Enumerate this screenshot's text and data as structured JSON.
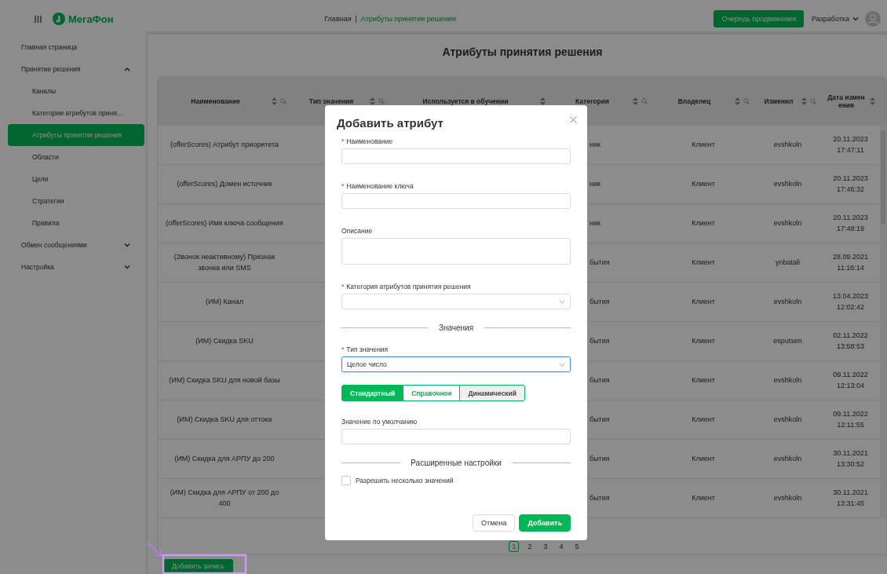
{
  "header": {
    "brand": "МегаФон",
    "breadcrumb": [
      {
        "label": "Главная",
        "current": false
      },
      {
        "label": "Атрибуты принятия решения",
        "current": true
      }
    ],
    "breadcrumb_separator": "|",
    "queue_button": "Очередь продвижения",
    "environment": "Разработка"
  },
  "sidebar": {
    "items": [
      {
        "label": "Главная страница",
        "selected": false
      },
      {
        "label": "Принятие решения",
        "selected": false,
        "expanded": true,
        "children": [
          {
            "label": "Каналы",
            "selected": false
          },
          {
            "label": "Категории атрибутов приня...",
            "selected": false
          },
          {
            "label": "Атрибуты принятия решения",
            "selected": true
          },
          {
            "label": "Области",
            "selected": false
          },
          {
            "label": "Цели",
            "selected": false
          },
          {
            "label": "Стратегии",
            "selected": false
          },
          {
            "label": "Правила",
            "selected": false
          }
        ]
      },
      {
        "label": "Обмен сообщениями",
        "selected": false,
        "expanded": false
      },
      {
        "label": "Настройка",
        "selected": false,
        "expanded": false
      }
    ]
  },
  "page_title": "Атрибуты принятия решения",
  "table": {
    "columns": [
      {
        "label": "Наименование",
        "sortable": true,
        "searchable": true
      },
      {
        "label": "Тип значения",
        "sortable": true,
        "searchable": true
      },
      {
        "label": "Используется в обучении",
        "sortable": true,
        "searchable": false
      },
      {
        "label": "Категория",
        "sortable": true,
        "searchable": true
      },
      {
        "label": "Владелец",
        "sortable": true,
        "searchable": true
      },
      {
        "label": "Изменил",
        "sortable": true,
        "searchable": true
      },
      {
        "label": "Дата изменения",
        "sortable": true,
        "searchable": false
      }
    ],
    "rows": [
      {
        "name": "(offerScores) Атрибут приоритета",
        "category": "ник",
        "owner": "Клиент",
        "changed_by": "evshkoln",
        "date": "20.11.2023 17:47:11"
      },
      {
        "name": "(offerScores) Домен источник",
        "category": "ник",
        "owner": "Клиент",
        "changed_by": "evshkoln",
        "date": "20.11.2023 17:46:32"
      },
      {
        "name": "(offerScores) Имя ключа сообщения",
        "category": "ник",
        "owner": "Клиент",
        "changed_by": "evshkoln",
        "date": "20.11.2023 17:48:19"
      },
      {
        "name": "(Звонок неактивному) Признак звонка или SMS",
        "category": "бытия",
        "owner": "Клиент",
        "changed_by": "ynbatali",
        "date": "28.09.2021 11:16:14"
      },
      {
        "name": "(ИМ) Канал",
        "category": "бытия",
        "owner": "Клиент",
        "changed_by": "evshkoln",
        "date": "13.04.2023 12:02:42"
      },
      {
        "name": "(ИМ) Скидка SKU",
        "category": "бытия",
        "owner": "Клиент",
        "changed_by": "esputsen",
        "date": "02.11.2022 13:58:53"
      },
      {
        "name": "(ИМ) Скидка SKU для новой базы",
        "category": "бытия",
        "owner": "Клиент",
        "changed_by": "evshkoln",
        "date": "09.11.2022 12:13:04"
      },
      {
        "name": "(ИМ) Скидка SKU для оттока",
        "category": "бытия",
        "owner": "Клиент",
        "changed_by": "evshkoln",
        "date": "09.11.2022 12:11:55"
      },
      {
        "name": "(ИМ) Скидка для АРПУ до 200",
        "category": "бытия",
        "owner": "Клиент",
        "changed_by": "evshkoln",
        "date": "30.11.2021 13:30:52"
      },
      {
        "name": "(ИМ) Скидка для АРПУ от 200 до 400",
        "category": "бытия",
        "owner": "Клиент",
        "changed_by": "evshkoln",
        "date": "30.11.2021 13:31:45"
      }
    ]
  },
  "pagination": [
    {
      "label": "1",
      "selected": true
    },
    {
      "label": "2",
      "selected": false
    },
    {
      "label": "3",
      "selected": false
    },
    {
      "label": "4",
      "selected": false
    },
    {
      "label": "5",
      "selected": false
    }
  ],
  "add_record_button": "Добавить запись",
  "modal": {
    "title": "Добавить атрибут",
    "required_mark": "*",
    "fields": [
      {
        "kind": "text",
        "label": "Наименование",
        "required": true
      },
      {
        "kind": "text",
        "label": "Наименование ключа",
        "required": true
      },
      {
        "kind": "textarea",
        "label": "Описание",
        "required": false
      },
      {
        "kind": "select",
        "label": "Категория атрибутов принятия решения",
        "required": true,
        "focused": false
      },
      {
        "kind": "divider",
        "label": "Значения"
      },
      {
        "kind": "select",
        "label": "Тип значения",
        "required": true,
        "value": "Целое число",
        "focused": true
      },
      {
        "kind": "segmented",
        "options": [
          {
            "label": "Стандартный",
            "selected": true,
            "disabled": false
          },
          {
            "label": "Справочное",
            "selected": false,
            "disabled": false
          },
          {
            "label": "Динамический",
            "selected": false,
            "disabled": true
          }
        ]
      },
      {
        "kind": "text",
        "label": "Значение по умолчанию",
        "required": false
      },
      {
        "kind": "divider",
        "label": "Расширенные настройки"
      },
      {
        "kind": "checkbox",
        "label": "Разрешить несколько значений",
        "checked": false
      }
    ],
    "cancel_button": "Отмена",
    "submit_button": "Добавить"
  }
}
